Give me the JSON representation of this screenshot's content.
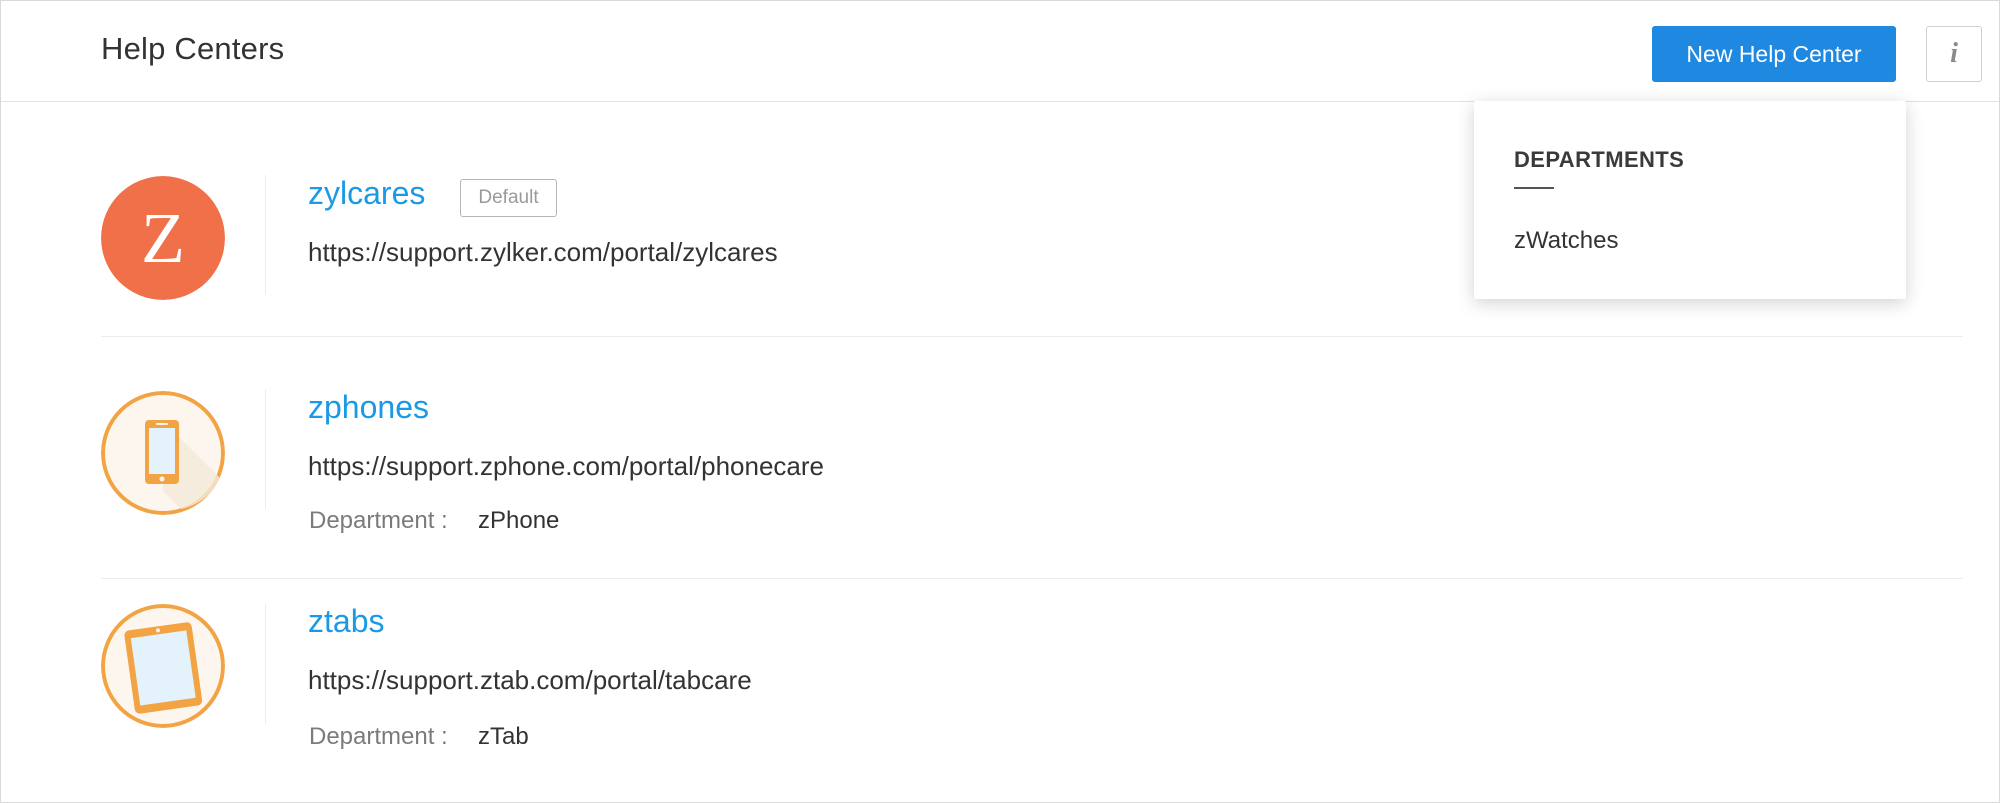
{
  "header": {
    "title": "Help Centers",
    "new_button_label": "New Help Center",
    "info_button_label": "i"
  },
  "help_centers": [
    {
      "name": "zylcares",
      "badge": "Default",
      "url": "https://support.zylker.com/portal/zylcares",
      "logo_letter": "Z",
      "logo_icon": "z-letter-logo-icon"
    },
    {
      "name": "zphones",
      "url": "https://support.zphone.com/portal/phonecare",
      "department_label": "Department :",
      "department": "zPhone",
      "logo_icon": "smartphone-icon"
    },
    {
      "name": "ztabs",
      "url": "https://support.ztab.com/portal/tabcare",
      "department_label": "Department :",
      "department": "zTab",
      "logo_icon": "tablet-icon"
    }
  ],
  "departments_popover": {
    "heading": "DEPARTMENTS",
    "items": [
      "zWatches"
    ]
  },
  "colors": {
    "accent_blue": "#1f88e0",
    "link_blue": "#1a9ae6",
    "zylcares_logo": "#f0704a",
    "device_logo": "#f2a444"
  }
}
